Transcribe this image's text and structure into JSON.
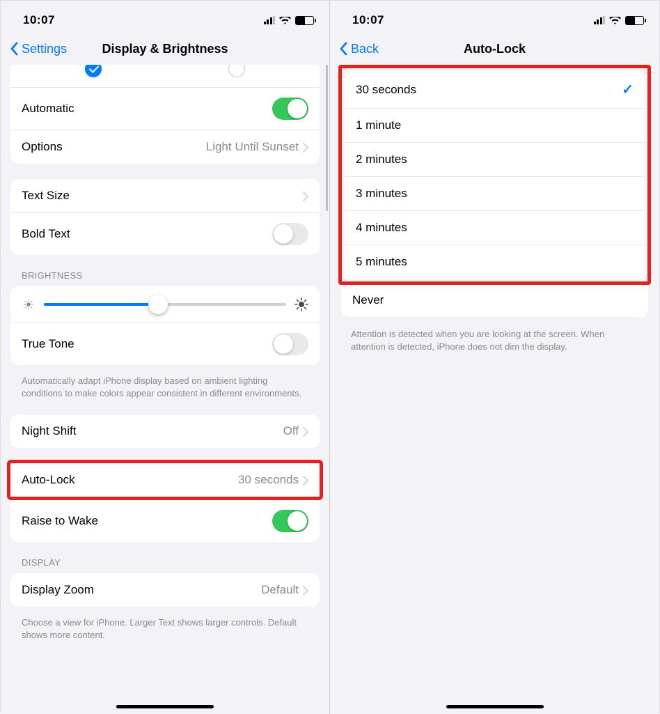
{
  "left": {
    "status_time": "10:07",
    "back_label": "Settings",
    "title": "Display & Brightness",
    "appearance": {
      "light_selected": true,
      "dark_selected": false
    },
    "automatic_label": "Automatic",
    "automatic_on": true,
    "options_label": "Options",
    "options_value": "Light Until Sunset",
    "text_size_label": "Text Size",
    "bold_text_label": "Bold Text",
    "bold_text_on": false,
    "brightness_header": "Brightness",
    "brightness_pct": 47,
    "true_tone_label": "True Tone",
    "true_tone_on": false,
    "true_tone_footer": "Automatically adapt iPhone display based on ambient lighting conditions to make colors appear consistent in different environments.",
    "night_shift_label": "Night Shift",
    "night_shift_value": "Off",
    "auto_lock_label": "Auto-Lock",
    "auto_lock_value": "30 seconds",
    "raise_to_wake_label": "Raise to Wake",
    "raise_to_wake_on": true,
    "display_header": "Display",
    "display_zoom_label": "Display Zoom",
    "display_zoom_value": "Default",
    "display_zoom_footer": "Choose a view for iPhone. Larger Text shows larger controls. Default shows more content."
  },
  "right": {
    "status_time": "10:07",
    "back_label": "Back",
    "title": "Auto-Lock",
    "options": [
      {
        "label": "30 seconds",
        "checked": true
      },
      {
        "label": "1 minute",
        "checked": false
      },
      {
        "label": "2 minutes",
        "checked": false
      },
      {
        "label": "3 minutes",
        "checked": false
      },
      {
        "label": "4 minutes",
        "checked": false
      },
      {
        "label": "5 minutes",
        "checked": false
      }
    ],
    "never_label": "Never",
    "footer": "Attention is detected when you are looking at the screen. When attention is detected, iPhone does not dim the display."
  }
}
